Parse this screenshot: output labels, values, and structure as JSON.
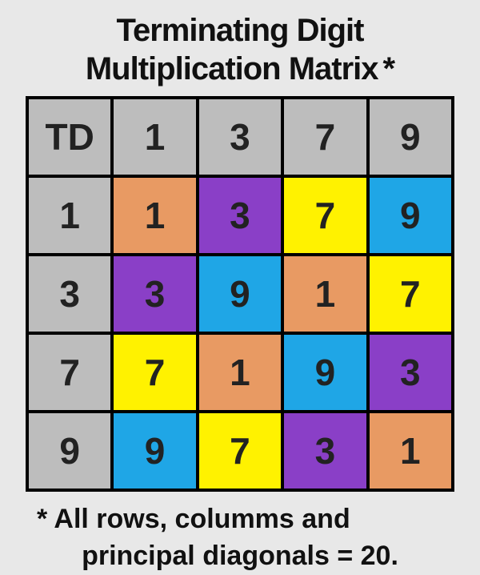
{
  "title": {
    "line1": "Terminating Digit",
    "line2": "Multiplication Matrix",
    "asterisk": "*"
  },
  "matrix": {
    "corner": "TD",
    "col_headers": [
      "1",
      "3",
      "7",
      "9"
    ],
    "row_headers": [
      "1",
      "3",
      "7",
      "9"
    ],
    "cells": [
      [
        {
          "v": "1",
          "color": "orange"
        },
        {
          "v": "3",
          "color": "purple"
        },
        {
          "v": "7",
          "color": "yellow"
        },
        {
          "v": "9",
          "color": "cyan"
        }
      ],
      [
        {
          "v": "3",
          "color": "purple"
        },
        {
          "v": "9",
          "color": "cyan"
        },
        {
          "v": "1",
          "color": "orange"
        },
        {
          "v": "7",
          "color": "yellow"
        }
      ],
      [
        {
          "v": "7",
          "color": "yellow"
        },
        {
          "v": "1",
          "color": "orange"
        },
        {
          "v": "9",
          "color": "cyan"
        },
        {
          "v": "3",
          "color": "purple"
        }
      ],
      [
        {
          "v": "9",
          "color": "cyan"
        },
        {
          "v": "7",
          "color": "yellow"
        },
        {
          "v": "3",
          "color": "purple"
        },
        {
          "v": "1",
          "color": "orange"
        }
      ]
    ]
  },
  "footnote": {
    "line1": "* All rows, columms and",
    "line2": "principal diagonals = 20."
  },
  "chart_data": {
    "type": "table",
    "title": "Terminating Digit Multiplication Matrix",
    "row_labels": [
      1,
      3,
      7,
      9
    ],
    "col_labels": [
      1,
      3,
      7,
      9
    ],
    "values": [
      [
        1,
        3,
        7,
        9
      ],
      [
        3,
        9,
        1,
        7
      ],
      [
        7,
        1,
        9,
        3
      ],
      [
        9,
        7,
        3,
        1
      ]
    ],
    "note": "All rows, columns and principal diagonals sum to 20",
    "color_groups": {
      "1": "orange",
      "3": "purple",
      "7": "yellow",
      "9": "cyan"
    }
  }
}
